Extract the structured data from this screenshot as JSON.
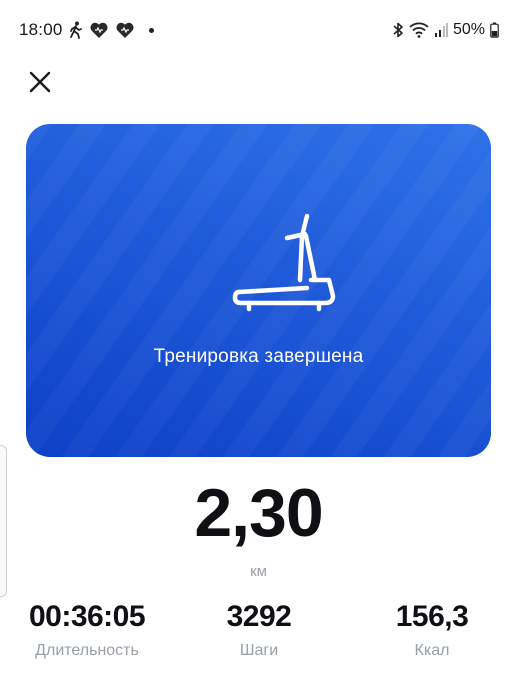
{
  "status_bar": {
    "time": "18:00",
    "battery": "50%",
    "icons": [
      "walking-icon",
      "heart-icon",
      "heart-icon",
      "bluetooth-icon",
      "wifi-icon",
      "signal-icon",
      "battery-icon"
    ]
  },
  "hero": {
    "title": "Тренировка завершена",
    "icon": "treadmill-icon",
    "color_top": "#2f72e8",
    "color_bottom": "#0d40c7"
  },
  "summary": {
    "distance_value": "2,30",
    "distance_unit": "км"
  },
  "stats": [
    {
      "value": "00:36:05",
      "label": "Длительность"
    },
    {
      "value": "3292",
      "label": "Шаги"
    },
    {
      "value": "156,3",
      "label": "Ккал"
    }
  ]
}
